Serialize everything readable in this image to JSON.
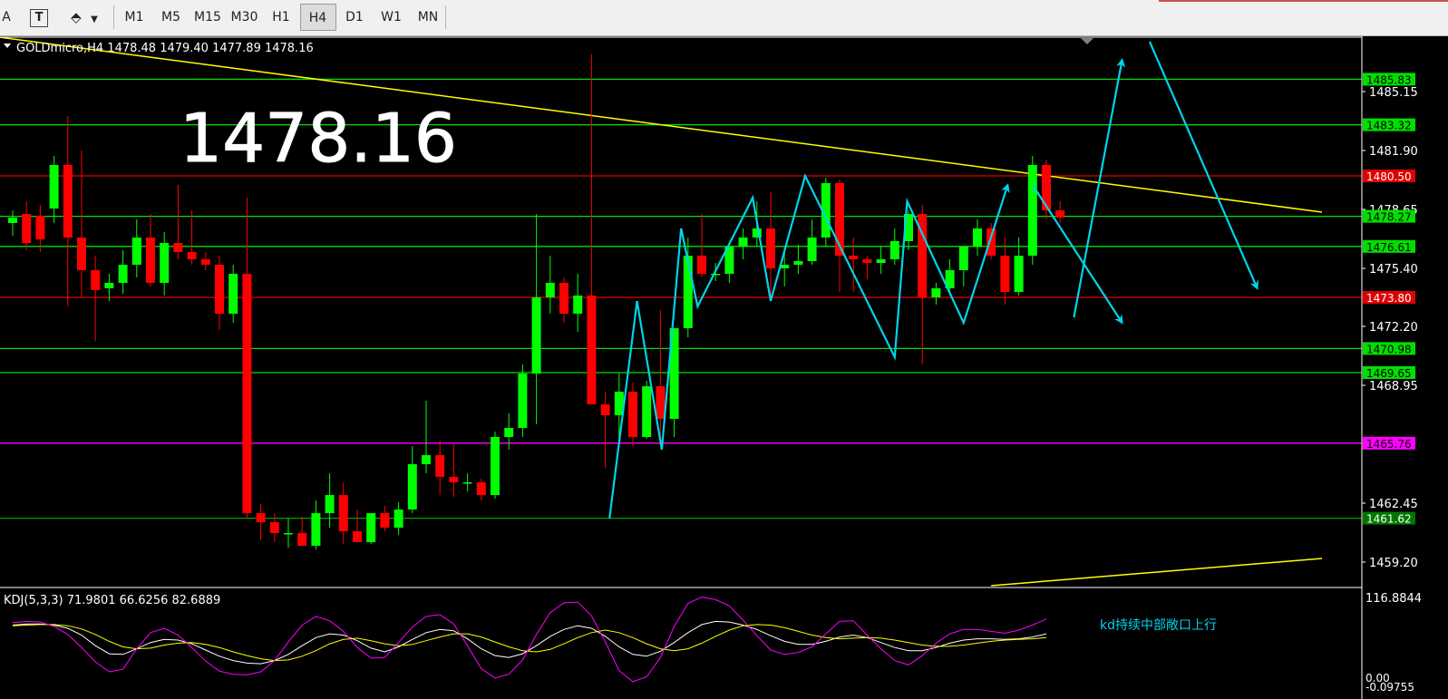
{
  "toolbar": {
    "partial_tool": "A",
    "text_tool": "T",
    "timeframes": [
      "M1",
      "M5",
      "M15",
      "M30",
      "H1",
      "H4",
      "D1",
      "W1",
      "MN"
    ],
    "active_timeframe": "H4"
  },
  "main_chart": {
    "header": "GOLDmicro,H4  1478.48 1479.40 1477.89 1478.16",
    "big_price": "1478.16",
    "axis_labels": [
      "1485.15",
      "1481.90",
      "1478.65",
      "1475.40",
      "1472.20",
      "1468.95",
      "1462.45",
      "1459.20"
    ],
    "levels": [
      {
        "value": 1485.83,
        "label": "1485.83",
        "color": "#00e000",
        "label_bg": "#00e000",
        "label_color": "#000000"
      },
      {
        "value": 1483.32,
        "label": "1483.32",
        "color": "#00e000",
        "label_bg": "#00e000",
        "label_color": "#000000"
      },
      {
        "value": 1480.5,
        "label": "1480.50",
        "color": "#e00000",
        "label_bg": "#e00000",
        "label_color": "#ffffff"
      },
      {
        "value": 1478.27,
        "label": "1478.27",
        "color": "#00e000",
        "label_bg": "#00e000",
        "label_color": "#000000"
      },
      {
        "value": 1476.61,
        "label": "1476.61",
        "color": "#00e000",
        "label_bg": "#00e000",
        "label_color": "#000000"
      },
      {
        "value": 1473.8,
        "label": "1473.80",
        "color": "#e00000",
        "label_bg": "#e00000",
        "label_color": "#ffffff"
      },
      {
        "value": 1470.98,
        "label": "1470.98",
        "color": "#00e000",
        "label_bg": "#00e000",
        "label_color": "#000000"
      },
      {
        "value": 1469.65,
        "label": "1469.65",
        "color": "#00e000",
        "label_bg": "#00e000",
        "label_color": "#000000"
      },
      {
        "value": 1465.76,
        "label": "1465.76",
        "color": "#ff00ff",
        "label_bg": "#ff00ff",
        "label_color": "#000000"
      },
      {
        "value": 1461.62,
        "label": "1461.62",
        "color": "#00a000",
        "label_bg": "#007800",
        "label_color": "#ffffff"
      }
    ],
    "colors": {
      "up": "#00ff00",
      "down": "#ff0000",
      "trend": "#ffff00",
      "forecast": "#00d4e8",
      "grid_text": "#ffffff"
    }
  },
  "chart_data": {
    "type": "candlestick",
    "symbol": "GOLDmicro",
    "timeframe": "H4",
    "ylim": [
      1457.9,
      1488.2
    ],
    "ohlc": [
      [
        1477.9,
        1478.6,
        1477.2,
        1478.2
      ],
      [
        1478.4,
        1479.1,
        1476.4,
        1476.8
      ],
      [
        1478.3,
        1478.9,
        1476.3,
        1477.0
      ],
      [
        1478.7,
        1481.6,
        1477.9,
        1481.1
      ],
      [
        1481.1,
        1483.8,
        1473.3,
        1477.1
      ],
      [
        1477.1,
        1481.9,
        1473.8,
        1475.3
      ],
      [
        1475.3,
        1476.1,
        1471.4,
        1474.2
      ],
      [
        1474.3,
        1475.1,
        1473.6,
        1474.6
      ],
      [
        1474.6,
        1476.4,
        1474.0,
        1475.6
      ],
      [
        1475.6,
        1478.1,
        1474.9,
        1477.1
      ],
      [
        1477.1,
        1478.4,
        1474.4,
        1474.6
      ],
      [
        1474.6,
        1477.4,
        1473.9,
        1476.8
      ],
      [
        1476.8,
        1480.0,
        1475.9,
        1476.3
      ],
      [
        1476.3,
        1478.6,
        1475.6,
        1475.9
      ],
      [
        1475.9,
        1476.3,
        1475.3,
        1475.6
      ],
      [
        1475.6,
        1476.1,
        1472.0,
        1472.9
      ],
      [
        1472.9,
        1475.6,
        1472.4,
        1475.1
      ],
      [
        1475.1,
        1479.3,
        1461.6,
        1461.9
      ],
      [
        1461.9,
        1462.4,
        1460.4,
        1461.4
      ],
      [
        1461.4,
        1461.9,
        1460.3,
        1460.8
      ],
      [
        1460.8,
        1461.6,
        1460.0,
        1460.8
      ],
      [
        1460.8,
        1461.7,
        1460.1,
        1460.1
      ],
      [
        1460.1,
        1462.6,
        1459.9,
        1461.9
      ],
      [
        1461.9,
        1464.1,
        1461.1,
        1462.9
      ],
      [
        1462.9,
        1463.6,
        1460.2,
        1460.9
      ],
      [
        1460.9,
        1462.1,
        1460.3,
        1460.3
      ],
      [
        1460.3,
        1461.8,
        1460.2,
        1461.9
      ],
      [
        1461.9,
        1462.3,
        1460.9,
        1461.1
      ],
      [
        1461.1,
        1462.5,
        1460.7,
        1462.1
      ],
      [
        1462.1,
        1465.6,
        1461.9,
        1464.6
      ],
      [
        1464.6,
        1468.1,
        1464.1,
        1465.1
      ],
      [
        1465.1,
        1465.9,
        1462.9,
        1463.9
      ],
      [
        1463.9,
        1465.7,
        1462.8,
        1463.6
      ],
      [
        1463.6,
        1464.1,
        1463.1,
        1463.6
      ],
      [
        1463.6,
        1463.8,
        1462.6,
        1462.9
      ],
      [
        1462.9,
        1466.4,
        1462.7,
        1466.1
      ],
      [
        1466.1,
        1467.4,
        1465.4,
        1466.6
      ],
      [
        1466.6,
        1470.1,
        1466.1,
        1469.6
      ],
      [
        1469.6,
        1478.4,
        1466.8,
        1473.8
      ],
      [
        1473.8,
        1476.1,
        1472.9,
        1474.6
      ],
      [
        1474.6,
        1474.9,
        1472.4,
        1472.9
      ],
      [
        1472.9,
        1475.1,
        1471.9,
        1473.9
      ],
      [
        1473.9,
        1487.2,
        1467.9,
        1467.9
      ],
      [
        1467.9,
        1468.6,
        1464.4,
        1467.3
      ],
      [
        1467.3,
        1469.6,
        1466.1,
        1468.6
      ],
      [
        1468.6,
        1469.1,
        1465.6,
        1466.1
      ],
      [
        1466.1,
        1469.2,
        1466.0,
        1468.9
      ],
      [
        1468.9,
        1473.1,
        1465.6,
        1467.1
      ],
      [
        1467.1,
        1472.1,
        1466.1,
        1472.1
      ],
      [
        1472.1,
        1477.1,
        1471.6,
        1476.1
      ],
      [
        1476.1,
        1478.4,
        1474.9,
        1475.1
      ],
      [
        1475.1,
        1475.7,
        1474.7,
        1475.1
      ],
      [
        1475.1,
        1476.1,
        1474.6,
        1476.6
      ],
      [
        1476.6,
        1477.6,
        1475.9,
        1477.1
      ],
      [
        1477.1,
        1479.1,
        1476.6,
        1477.6
      ],
      [
        1477.6,
        1479.6,
        1473.6,
        1475.4
      ],
      [
        1475.4,
        1476.4,
        1474.4,
        1475.6
      ],
      [
        1475.6,
        1476.7,
        1475.1,
        1475.8
      ],
      [
        1475.8,
        1478.1,
        1475.6,
        1477.1
      ],
      [
        1477.1,
        1480.4,
        1476.6,
        1480.1
      ],
      [
        1480.1,
        1480.3,
        1474.1,
        1476.1
      ],
      [
        1476.1,
        1477.1,
        1474.1,
        1475.9
      ],
      [
        1475.9,
        1476.1,
        1474.8,
        1475.7
      ],
      [
        1475.7,
        1476.6,
        1475.1,
        1475.9
      ],
      [
        1475.9,
        1477.6,
        1475.6,
        1476.9
      ],
      [
        1476.9,
        1478.6,
        1476.4,
        1478.4
      ],
      [
        1478.4,
        1478.9,
        1470.1,
        1473.8
      ],
      [
        1473.8,
        1474.6,
        1473.4,
        1474.3
      ],
      [
        1474.3,
        1475.9,
        1473.9,
        1475.3
      ],
      [
        1475.3,
        1476.6,
        1474.4,
        1476.6
      ],
      [
        1476.6,
        1478.1,
        1476.1,
        1477.6
      ],
      [
        1477.6,
        1477.9,
        1475.9,
        1476.1
      ],
      [
        1476.1,
        1477.1,
        1473.4,
        1474.1
      ],
      [
        1474.1,
        1477.1,
        1473.9,
        1476.1
      ],
      [
        1476.1,
        1481.6,
        1475.6,
        1481.1
      ],
      [
        1481.1,
        1481.4,
        1478.1,
        1478.6
      ],
      [
        1478.6,
        1479.1,
        1477.9,
        1478.2
      ]
    ],
    "trendlines": [
      {
        "from": [
          -1.5,
          1488.2
        ],
        "to": [
          95,
          1478.5
        ]
      },
      {
        "from": [
          71,
          1457.9
        ],
        "to": [
          95,
          1459.4
        ]
      }
    ],
    "forecast_arrows": [
      {
        "points": [
          [
            43.3,
            1461.6
          ],
          [
            45.3,
            1473.6
          ],
          [
            47.1,
            1465.4
          ],
          [
            48.5,
            1477.6
          ],
          [
            49.7,
            1473.3
          ],
          [
            53.7,
            1479.3
          ],
          [
            55.0,
            1473.6
          ],
          [
            57.5,
            1480.5
          ],
          [
            64.0,
            1470.5
          ],
          [
            64.9,
            1479.1
          ],
          [
            69.0,
            1472.4
          ],
          [
            72.2,
            1480.0
          ]
        ]
      },
      {
        "points": [
          [
            74.0,
            1480.0
          ],
          [
            80.5,
            1472.4
          ]
        ]
      },
      {
        "points": [
          [
            77.0,
            1472.7
          ],
          [
            80.5,
            1486.9
          ]
        ]
      },
      {
        "points": [
          [
            82.5,
            1487.9
          ],
          [
            90.3,
            1474.3
          ]
        ]
      }
    ],
    "indicator": {
      "name": "KDJ(5,3,3)",
      "values": [
        "71.9801",
        "66.6256",
        "82.6889"
      ],
      "ylim_labels": [
        "116.8844",
        "0.00",
        "-0.09755"
      ],
      "note": "kd持续中部敞口上行",
      "series": [
        {
          "name": "K",
          "color": "#ffffff",
          "values": [
            74,
            76,
            76,
            74,
            69,
            58,
            41,
            28,
            27,
            36,
            46,
            51,
            50,
            44,
            34,
            24,
            17,
            13,
            12,
            17,
            27,
            41,
            54,
            60,
            58,
            49,
            37,
            31,
            39,
            51,
            62,
            67,
            65,
            52,
            36,
            25,
            22,
            28,
            41,
            56,
            67,
            73,
            69,
            56,
            39,
            27,
            24,
            32,
            46,
            62,
            75,
            80,
            79,
            74,
            67,
            57,
            48,
            43,
            43,
            48,
            55,
            58,
            54,
            46,
            38,
            33,
            33,
            38,
            45,
            50,
            52,
            52,
            51,
            52,
            55,
            60
          ]
        },
        {
          "name": "D",
          "color": "#ffff00",
          "values": [
            73,
            74,
            75,
            75,
            73,
            68,
            59,
            48,
            39,
            36,
            37,
            42,
            45,
            46,
            43,
            38,
            31,
            25,
            20,
            17,
            18,
            24,
            33,
            44,
            51,
            53,
            49,
            44,
            41,
            43,
            49,
            55,
            60,
            60,
            55,
            47,
            39,
            33,
            31,
            35,
            44,
            54,
            62,
            66,
            62,
            54,
            44,
            36,
            33,
            36,
            45,
            56,
            66,
            73,
            75,
            74,
            70,
            64,
            58,
            54,
            52,
            53,
            54,
            53,
            50,
            46,
            42,
            40,
            40,
            42,
            45,
            48,
            50,
            51,
            52,
            54
          ]
        },
        {
          "name": "J",
          "color": "#ff00ff",
          "values": [
            78,
            80,
            79,
            72,
            59,
            38,
            15,
            -1,
            3,
            36,
            62,
            69,
            58,
            38,
            16,
            0,
            -5,
            -6,
            -1,
            17,
            47,
            74,
            88,
            81,
            64,
            38,
            21,
            22,
            46,
            71,
            88,
            91,
            76,
            41,
            4,
            -11,
            -5,
            18,
            59,
            94,
            110,
            111,
            89,
            47,
            1,
            -17,
            -9,
            22,
            72,
            109,
            119,
            115,
            105,
            82,
            57,
            34,
            27,
            30,
            39,
            60,
            80,
            81,
            58,
            36,
            17,
            10,
            25,
            45,
            60,
            67,
            67,
            64,
            61,
            66,
            74,
            84
          ]
        }
      ]
    }
  }
}
